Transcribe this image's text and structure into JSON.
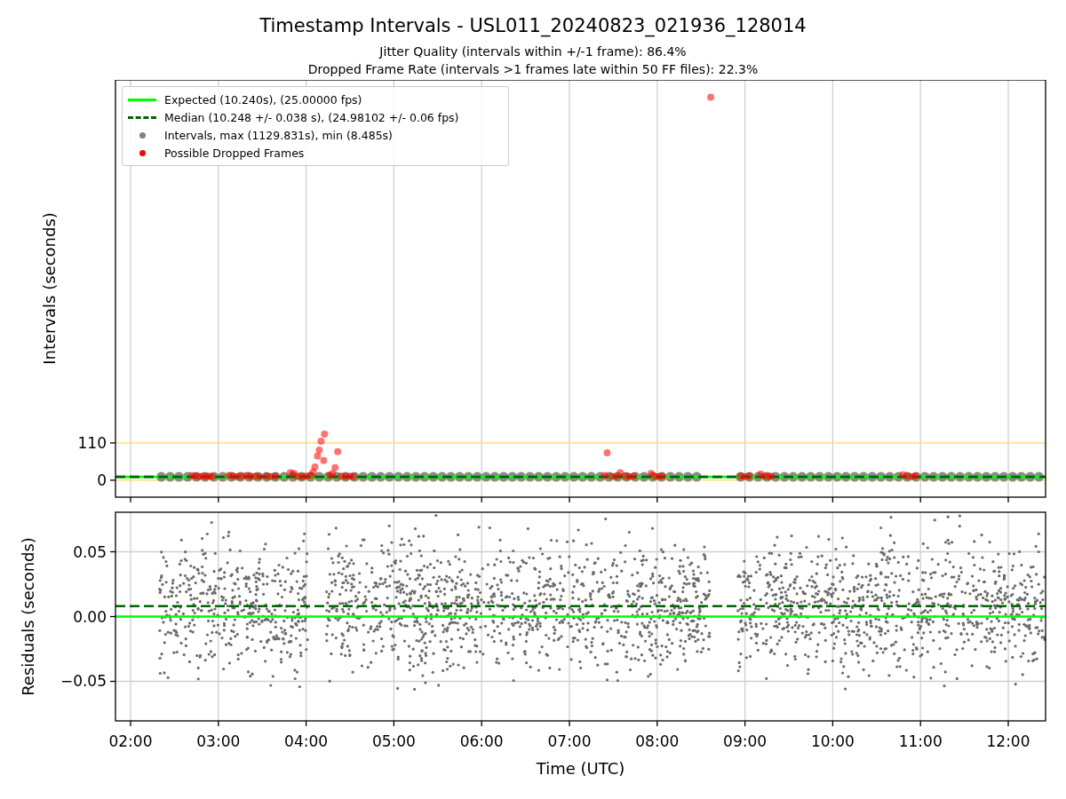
{
  "figure": {
    "title": "Timestamp Intervals - USL011_20240823_021936_128014",
    "subtitles": [
      "Jitter Quality (intervals within +/-1 frame): 86.4%",
      "Dropped Frame Rate (intervals >1 frames late within 50 FF files): 22.3%"
    ]
  },
  "legend": [
    {
      "label": "Expected (10.240s), (25.00000 fps)",
      "kind": "line",
      "color": "#00ff00"
    },
    {
      "label": "Median (10.248 +/- 0.038 s), (24.98102 +/- 0.06 fps)",
      "kind": "dashed",
      "color": "#006400"
    },
    {
      "label": "Intervals, max (1129.831s), min (8.485s)",
      "kind": "dot",
      "color": "#808080"
    },
    {
      "label": "Possible Dropped Frames",
      "kind": "dot",
      "color": "#ff0000"
    }
  ],
  "plots": [
    {
      "chart_data": {
        "type": "scatter",
        "ylabel": "Intervals (seconds)",
        "xlim": [
          1.828,
          12.425
        ],
        "ylim": [
          -50,
          1181
        ],
        "yticks": [
          {
            "value": 0,
            "label": "0"
          },
          {
            "value": 110,
            "label": "110"
          }
        ],
        "grid": true,
        "ref_lines": [
          {
            "axis": "y",
            "value": 110,
            "color": "#ffd966"
          },
          {
            "axis": "y",
            "value": 0,
            "color": "#ffd966"
          },
          {
            "axis": "y",
            "value": 10,
            "color": "#00ff00"
          },
          {
            "axis": "y",
            "value": 10,
            "color": "#006400"
          }
        ],
        "series": [
          {
            "color": "#808080",
            "x": [
              2.35,
              2.45,
              2.55,
              2.65,
              2.75,
              2.85,
              2.95,
              3.05,
              3.15,
              3.25,
              3.35,
              3.45,
              3.55,
              3.65,
              3.75,
              3.85,
              3.95,
              4.05,
              4.15,
              4.25,
              4.35,
              4.45,
              4.55,
              4.65,
              4.75,
              4.85,
              4.95,
              5.05,
              5.15,
              5.25,
              5.35,
              5.45,
              5.55,
              5.65,
              5.75,
              5.85,
              5.95,
              6.05,
              6.15,
              6.25,
              6.35,
              6.45,
              6.55,
              6.65,
              6.75,
              6.85,
              6.95,
              7.05,
              7.15,
              7.25,
              7.35,
              7.45,
              7.55,
              7.65,
              7.75,
              7.85,
              7.95,
              8.05,
              8.15,
              8.25,
              8.35,
              8.45,
              8.95,
              9.05,
              9.15,
              9.25,
              9.35,
              9.45,
              9.55,
              9.65,
              9.75,
              9.85,
              9.95,
              10.05,
              10.15,
              10.25,
              10.35,
              10.45,
              10.55,
              10.65,
              10.75,
              10.85,
              10.95,
              11.05,
              11.15,
              11.25,
              11.35,
              11.45,
              11.55,
              11.65,
              11.75,
              11.85,
              11.95,
              12.05,
              12.15,
              12.25,
              12.35
            ],
            "values": [
              10,
              10,
              10,
              10,
              10,
              10,
              10,
              10,
              10,
              10,
              10,
              10,
              10,
              10,
              10,
              10,
              10,
              10,
              10,
              10,
              10,
              10,
              10,
              10,
              10,
              10,
              10,
              10,
              10,
              10,
              10,
              10,
              10,
              10,
              10,
              10,
              10,
              10,
              10,
              10,
              10,
              10,
              10,
              10,
              10,
              10,
              10,
              10,
              10,
              10,
              10,
              10,
              10,
              10,
              10,
              10,
              10,
              10,
              10,
              10,
              10,
              10,
              10,
              10,
              10,
              10,
              10,
              10,
              10,
              10,
              10,
              10,
              10,
              10,
              10,
              10,
              10,
              10,
              10,
              10,
              10,
              10,
              10,
              10,
              10,
              10,
              10,
              10,
              10,
              10,
              10,
              10,
              10,
              10,
              10,
              10,
              10
            ]
          },
          {
            "color": "#ff0000",
            "x": [
              2.7,
              2.74,
              2.78,
              2.82,
              2.86,
              2.9,
              2.93,
              3.12,
              3.17,
              3.22,
              3.27,
              3.32,
              3.37,
              3.42,
              3.47,
              3.55,
              3.6,
              3.65,
              3.82,
              3.86,
              3.9,
              3.95,
              4.0,
              4.05,
              4.08,
              4.1,
              4.13,
              4.15,
              4.17,
              4.2,
              4.21,
              4.27,
              4.3,
              4.33,
              4.36,
              4.4,
              4.45,
              4.5,
              4.54,
              7.4,
              7.43,
              7.48,
              7.53,
              7.58,
              7.63,
              7.68,
              7.73,
              7.93,
              7.97,
              8.02,
              8.06,
              8.61,
              8.95,
              9.0,
              9.05,
              9.18,
              9.22,
              9.27,
              9.3,
              10.8,
              10.85,
              10.9,
              10.94
            ],
            "values": [
              14,
              12,
              11,
              12,
              11,
              12,
              11,
              14,
              12,
              11,
              12,
              14,
              11,
              12,
              11,
              12,
              11,
              12,
              22,
              20,
              12,
              11,
              12,
              14,
              24,
              39,
              71,
              89,
              115,
              58,
              136,
              14,
              20,
              37,
              84,
              12,
              11,
              12,
              11,
              14,
              81,
              12,
              11,
              22,
              12,
              11,
              12,
              20,
              12,
              11,
              12,
              1130,
              12,
              11,
              12,
              18,
              12,
              11,
              12,
              16,
              12,
              11,
              12
            ]
          }
        ]
      }
    },
    {
      "chart_data": {
        "type": "scatter",
        "xlabel": "Time (UTC)",
        "ylabel": "Residuals (seconds)",
        "xlim": [
          1.828,
          12.425
        ],
        "ylim": [
          -0.0805,
          0.0805
        ],
        "grid": true,
        "xticks": [
          {
            "value": 2,
            "label": "02:00"
          },
          {
            "value": 3,
            "label": "03:00"
          },
          {
            "value": 4,
            "label": "04:00"
          },
          {
            "value": 5,
            "label": "05:00"
          },
          {
            "value": 6,
            "label": "06:00"
          },
          {
            "value": 7,
            "label": "07:00"
          },
          {
            "value": 8,
            "label": "08:00"
          },
          {
            "value": 9,
            "label": "09:00"
          },
          {
            "value": 10,
            "label": "10:00"
          },
          {
            "value": 11,
            "label": "11:00"
          },
          {
            "value": 12,
            "label": "12:00"
          }
        ],
        "yticks": [
          {
            "value": -0.05,
            "label": "−0.05"
          },
          {
            "value": 0,
            "label": "0.00"
          },
          {
            "value": 0.05,
            "label": "0.05"
          }
        ],
        "ref_lines": [
          {
            "axis": "y",
            "value": 0,
            "color": "#00ff00"
          },
          {
            "axis": "y",
            "value": 0.008,
            "color": "#006400"
          }
        ]
      }
    }
  ]
}
